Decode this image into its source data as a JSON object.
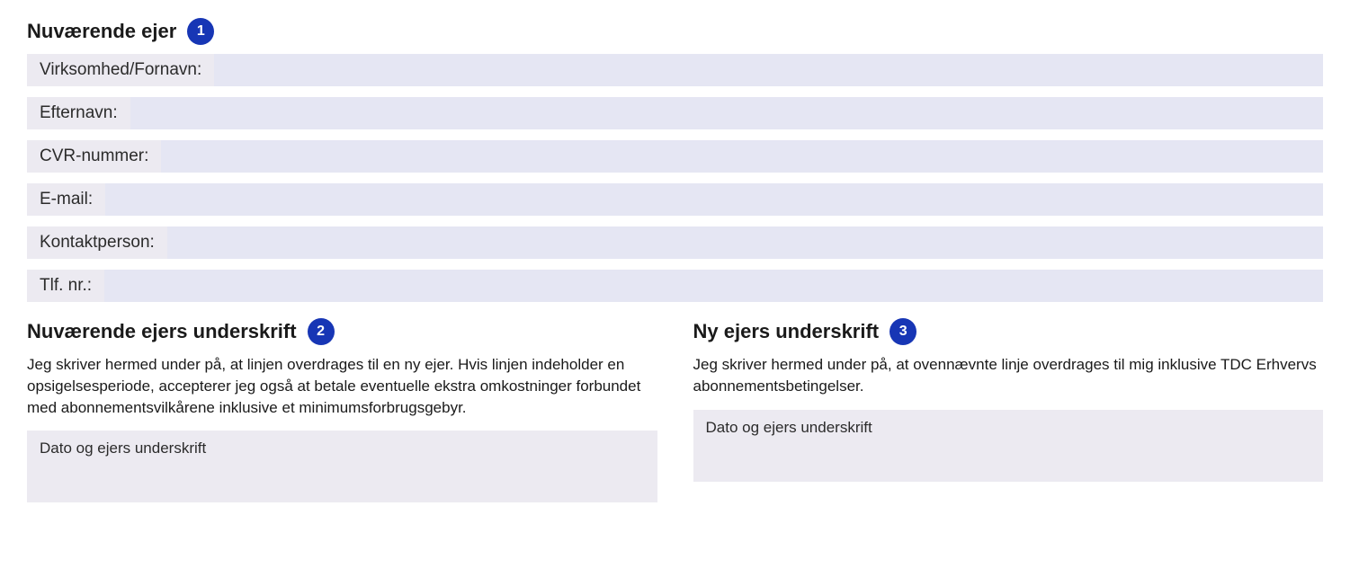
{
  "section1": {
    "badge": "1",
    "heading": "Nuværende ejer",
    "fields": [
      {
        "label": "Virksomhed/Fornavn:",
        "value": ""
      },
      {
        "label": "Efternavn:",
        "value": ""
      },
      {
        "label": "CVR-nummer:",
        "value": ""
      },
      {
        "label": "E-mail:",
        "value": ""
      },
      {
        "label": "Kontaktperson:",
        "value": ""
      },
      {
        "label": "Tlf. nr.:",
        "value": ""
      }
    ]
  },
  "sig_current": {
    "badge": "2",
    "heading": "Nuværende ejers underskrift",
    "text": "Jeg skriver hermed under på, at linjen overdrages til en ny ejer. Hvis linjen indeholder en opsigelsesperiode, accepterer jeg også at betale eventuelle ekstra omkostninger forbundet med abonnementsvilkårene inklusive et minimumsforbrugsgebyr.",
    "box_label": "Dato og ejers underskrift"
  },
  "sig_new": {
    "badge": "3",
    "heading": "Ny ejers underskrift",
    "text": "Jeg skriver hermed under på, at ovennævnte linje overdrages til mig inklusive TDC Erhvervs abonnementsbetingelser.",
    "box_label": "Dato og ejers underskrift"
  }
}
